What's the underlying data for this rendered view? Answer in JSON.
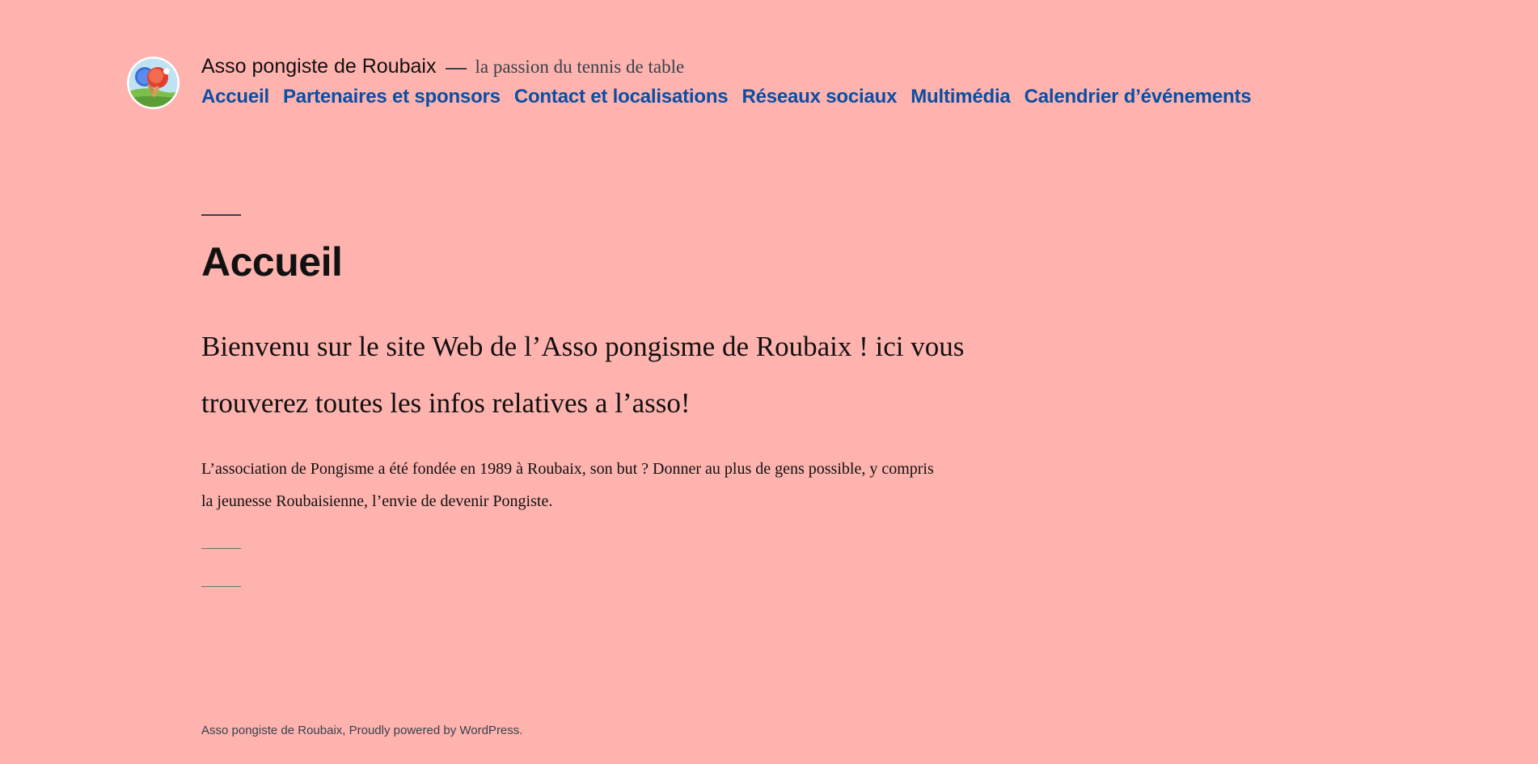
{
  "header": {
    "site_title": "Asso pongiste de Roubaix",
    "tagline": "la passion du tennis de table",
    "logo_icon": "table-tennis-logo-icon"
  },
  "nav": {
    "items": [
      {
        "label": "Accueil"
      },
      {
        "label": "Partenaires et sponsors"
      },
      {
        "label": "Contact et localisations"
      },
      {
        "label": "Réseaux sociaux"
      },
      {
        "label": "Multimédia"
      },
      {
        "label": "Calendrier d’événements"
      }
    ]
  },
  "main": {
    "title": "Accueil",
    "lead": "Bienvenu sur le site Web de l’Asso pongisme de Roubaix ! ici vous trouverez toutes les infos relatives a l’asso!",
    "paragraph": "L’association de Pongisme a été fondée en 1989 à Roubaix, son but ? Donner au plus de gens possible, y compris la jeunesse Roubaisienne, l’envie de devenir Pongiste."
  },
  "footer": {
    "site_link": "Asso pongiste de Roubaix",
    "separator": ", ",
    "powered_link": "Proudly powered by WordPress",
    "period": "."
  },
  "colors": {
    "background": "#ffb3ae",
    "link": "#0b4ea2",
    "text": "#111111",
    "secondary": "#39414d"
  }
}
